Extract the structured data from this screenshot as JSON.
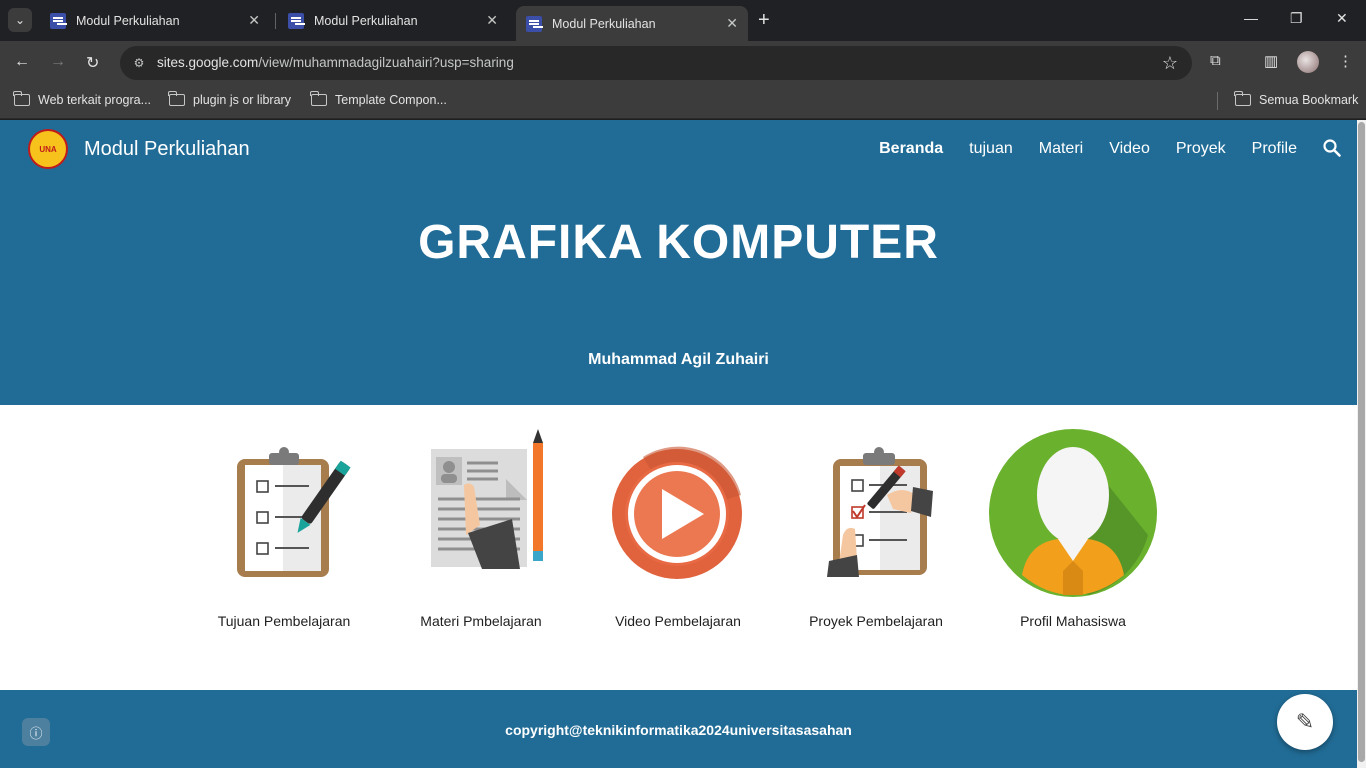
{
  "browser": {
    "tabs": [
      {
        "title": "Modul Perkuliahan"
      },
      {
        "title": "Modul Perkuliahan"
      },
      {
        "title": "Modul Perkuliahan"
      }
    ],
    "url_host": "sites.google.com",
    "url_path": "/view/muhammadagilzuahairi?usp=sharing",
    "bookmarks": [
      "Web terkait progra...",
      "plugin js or library",
      "Template Compon..."
    ],
    "all_bookmarks": "Semua Bookmark"
  },
  "site": {
    "title": "Modul Perkuliahan",
    "logo_text": "UNA",
    "nav": [
      "Beranda",
      "tujuan",
      "Materi",
      "Video",
      "Proyek",
      "Profile"
    ],
    "hero_title": "GRAFIKA KOMPUTER",
    "hero_subtitle": "Muhammad Agil Zuhairi",
    "cards": [
      {
        "caption": "Tujuan Pembelajaran",
        "icon": "clipboard-checklist-icon"
      },
      {
        "caption": "Materi Pmbelajaran",
        "icon": "document-pencil-icon"
      },
      {
        "caption": "Video Pembelajaran",
        "icon": "play-icon"
      },
      {
        "caption": "Proyek Pembelajaran",
        "icon": "clipboard-check-hand-icon"
      },
      {
        "caption": "Profil Mahasiswa",
        "icon": "user-profile-icon"
      }
    ],
    "footer": "copyright@teknikinformatika2024universitasasahan"
  },
  "colors": {
    "brand": "#216c96",
    "play": "#e86a44",
    "profile": "#6ab12e"
  }
}
